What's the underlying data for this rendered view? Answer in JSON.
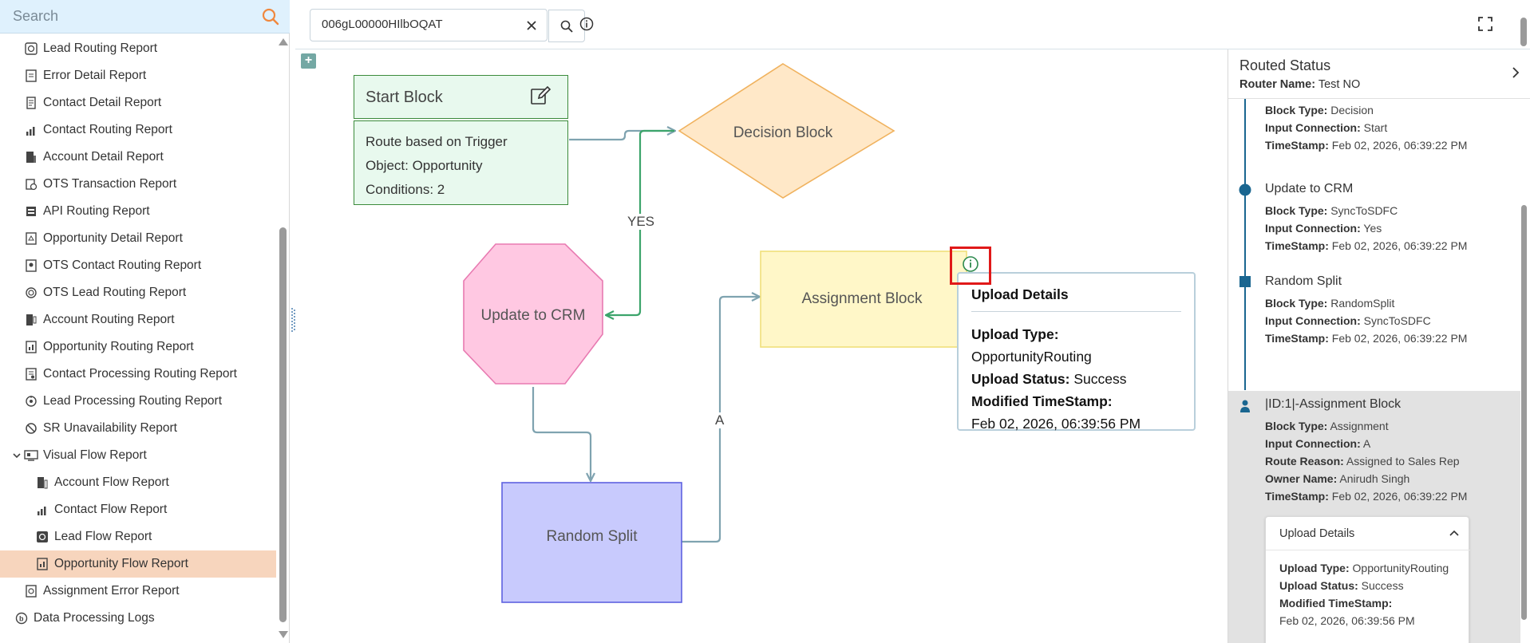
{
  "sidebar": {
    "search_placeholder": "Search",
    "items": [
      {
        "label": "Lead Routing Report",
        "icon": "lead-routing-icon"
      },
      {
        "label": "Error Detail Report",
        "icon": "error-report-icon"
      },
      {
        "label": "Contact Detail Report",
        "icon": "contact-detail-icon"
      },
      {
        "label": "Contact Routing Report",
        "icon": "chart-icon"
      },
      {
        "label": "Account Detail Report",
        "icon": "account-detail-icon"
      },
      {
        "label": "OTS Transaction Report",
        "icon": "transaction-icon"
      },
      {
        "label": "API Routing Report",
        "icon": "api-icon"
      },
      {
        "label": "Opportunity Detail Report",
        "icon": "opportunity-detail-icon"
      },
      {
        "label": "OTS Contact Routing Report",
        "icon": "contact-routing-icon"
      },
      {
        "label": "OTS Lead Routing Report",
        "icon": "lead-routing-icon"
      },
      {
        "label": "Account Routing Report",
        "icon": "account-routing-icon"
      },
      {
        "label": "Opportunity Routing Report",
        "icon": "opportunity-routing-icon"
      },
      {
        "label": "Contact Processing Routing Report",
        "icon": "processing-icon"
      },
      {
        "label": "Lead Processing Routing Report",
        "icon": "processing-icon"
      },
      {
        "label": "SR Unavailability Report",
        "icon": "unavailability-icon"
      },
      {
        "label": "Visual Flow Report",
        "icon": "visual-flow-icon"
      },
      {
        "label": "Account Flow Report",
        "icon": "account-flow-icon"
      },
      {
        "label": "Contact Flow Report",
        "icon": "chart-icon"
      },
      {
        "label": "Lead Flow Report",
        "icon": "lead-flow-icon"
      },
      {
        "label": "Opportunity Flow Report",
        "icon": "opportunity-flow-icon"
      },
      {
        "label": "Assignment Error Report",
        "icon": "assignment-error-icon"
      },
      {
        "label": "Data Processing Logs",
        "icon": "data-logs-icon"
      }
    ]
  },
  "topbar": {
    "record_id": "006gL00000HIlbOQAT"
  },
  "canvas": {
    "start_block": {
      "title": "Start Block",
      "line1": "Route based on Trigger",
      "line2": "Object: Opportunity",
      "line3": "Conditions: 2"
    },
    "decision_block": "Decision Block",
    "update_block": "Update to CRM",
    "assignment_block": "Assignment Block",
    "random_split": "Random Split",
    "edge_yes": "YES",
    "edge_a": "A",
    "upload_tip": {
      "title": "Upload Details",
      "type_label": "Upload Type:",
      "type_value": "OpportunityRouting",
      "status_label": "Upload Status:",
      "status_value": "Success",
      "modified_label": "Modified TimeStamp:",
      "modified_value": "Feb 02, 2026, 06:39:56 PM"
    }
  },
  "panel": {
    "title": "Routed Status",
    "router_label": "Router Name:",
    "router_value": "Test NO",
    "items": [
      {
        "title": "",
        "block_type_label": "Block Type:",
        "block_type": "Decision",
        "input_label": "Input Connection:",
        "input": "Start",
        "ts_label": "TimeStamp:",
        "ts": "Feb 02, 2026, 06:39:22 PM"
      },
      {
        "title": "Update to CRM",
        "block_type_label": "Block Type:",
        "block_type": "SyncToSDFC",
        "input_label": "Input Connection:",
        "input": "Yes",
        "ts_label": "TimeStamp:",
        "ts": "Feb 02, 2026, 06:39:22 PM"
      },
      {
        "title": "Random Split",
        "block_type_label": "Block Type:",
        "block_type": "RandomSplit",
        "input_label": "Input Connection:",
        "input": "SyncToSDFC",
        "ts_label": "TimeStamp:",
        "ts": "Feb 02, 2026, 06:39:22 PM"
      },
      {
        "title": "|ID:1|-Assignment Block",
        "block_type_label": "Block Type:",
        "block_type": "Assignment",
        "input_label": "Input Connection:",
        "input": "A",
        "reason_label": "Route Reason:",
        "reason": "Assigned to Sales Rep",
        "owner_label": "Owner Name:",
        "owner": "Anirudh Singh",
        "ts_label": "TimeStamp:",
        "ts": "Feb 02, 2026, 06:39:22 PM"
      }
    ],
    "upload": {
      "title": "Upload Details",
      "type_label": "Upload Type:",
      "type_value": "OpportunityRouting",
      "status_label": "Upload Status:",
      "status_value": "Success",
      "modified_label": "Modified TimeStamp:",
      "modified_value": "Feb 02, 2026, 06:39:56 PM"
    }
  },
  "colors": {
    "start_fill": "#e8f9ee",
    "start_stroke": "#3b8b3b",
    "decision_fill": "#ffe8c8",
    "decision_stroke": "#f0b25e",
    "update_fill": "#ffc8e2",
    "update_stroke": "#e87ab1",
    "assignment_fill": "#fff7c8",
    "assignment_stroke": "#f0e07a",
    "random_fill": "#c8cafd",
    "random_stroke": "#5e62e0",
    "edge_green": "#3ca46b",
    "edge_gray": "#7fa3b0",
    "active_nav": "#f7d5bd",
    "highlight": "#e01919"
  }
}
